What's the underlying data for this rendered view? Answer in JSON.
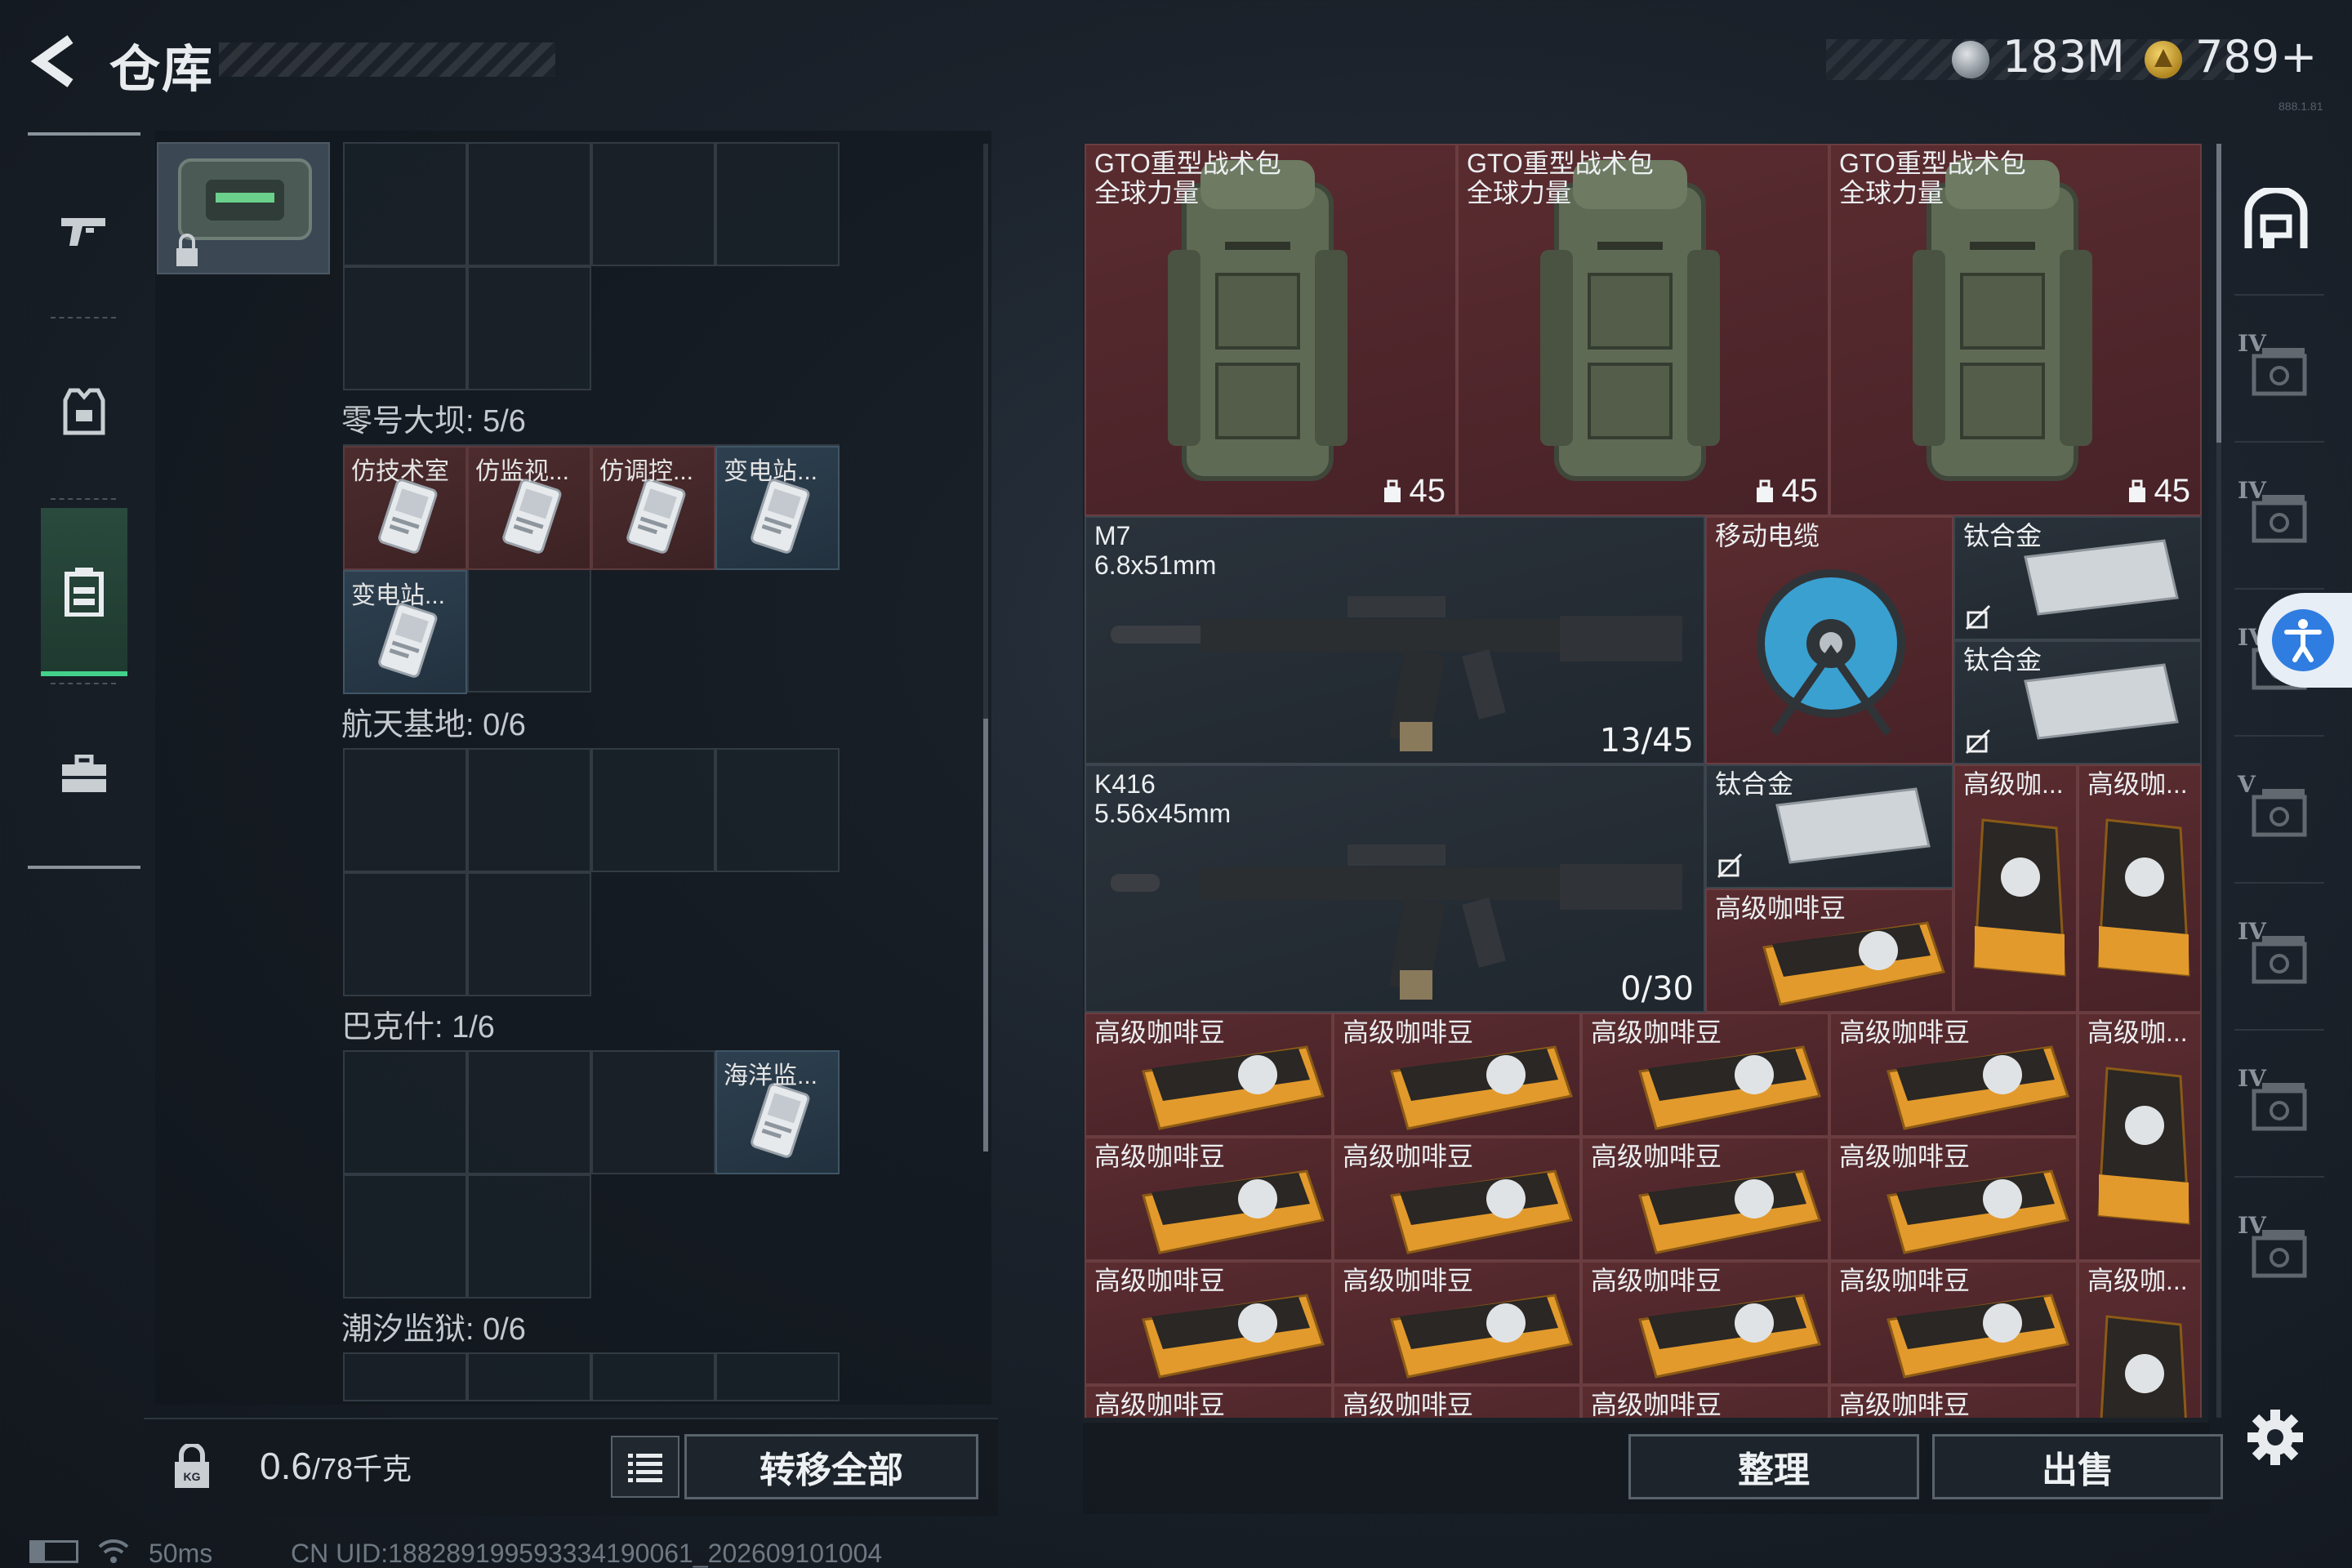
{
  "header": {
    "title": "仓库",
    "currency_1_value": "183M",
    "currency_2_value": "789",
    "currency_2_plus": "+",
    "version_text": "888.1.81"
  },
  "nav": {
    "items": [
      "gun-icon",
      "armor-vest-icon",
      "backpack-icon",
      "toolbox-icon"
    ],
    "active_index": 2
  },
  "left": {
    "sections": [
      {
        "label": "零号大坝: 5/6",
        "cards": [
          "仿技术室",
          "仿监视...",
          "仿调控...",
          "变电站...",
          "变电站..."
        ]
      },
      {
        "label": "航天基地: 0/6",
        "cards": []
      },
      {
        "label": "巴克什: 1/6",
        "cards": [
          "海洋监..."
        ]
      },
      {
        "label": "潮汐监狱: 0/6",
        "cards": []
      }
    ],
    "weight_current": "0.6",
    "weight_max": "/78千克",
    "transfer_all_label": "转移全部"
  },
  "stash": {
    "backpacks": [
      {
        "name": "GTO重型战术包",
        "sub": "全球力量",
        "capacity": "45"
      },
      {
        "name": "GTO重型战术包",
        "sub": "全球力量",
        "capacity": "45"
      },
      {
        "name": "GTO重型战术包",
        "sub": "全球力量",
        "capacity": "45"
      }
    ],
    "m7": {
      "name": "M7",
      "caliber": "6.8x51mm",
      "ammo": "13/45"
    },
    "k416": {
      "name": "K416",
      "caliber": "5.56x45mm",
      "ammo": "0/30"
    },
    "cable": "移动电缆",
    "titanium": "钛合金",
    "coffee": "高级咖啡豆",
    "coffee_short": "高级咖...",
    "coffee_rows": [
      [
        "高级咖啡豆",
        "高级咖啡豆",
        "高级咖啡豆",
        "高级咖啡豆",
        "高级咖..."
      ],
      [
        "高级咖啡豆",
        "高级咖啡豆",
        "高级咖啡豆",
        "高级咖啡豆"
      ],
      [
        "高级咖啡豆",
        "高级咖啡豆",
        "高级咖啡豆",
        "高级咖啡豆",
        "高级咖..."
      ],
      [
        "高级咖啡豆",
        "高级咖啡豆",
        "高级咖啡豆",
        "高级咖啡豆"
      ]
    ],
    "side_levels": [
      "IV",
      "IV",
      "IV",
      "V",
      "IV",
      "IV",
      "IV"
    ],
    "sort_label": "整理",
    "sell_label": "出售"
  },
  "status": {
    "ping": "50ms",
    "uid": "CN UID:18828919959333419006‌1_202609101004"
  },
  "colors": {
    "accent_green": "#42d08a",
    "item_red": "#5a2c30",
    "accessibility_blue": "#2f7de1"
  }
}
